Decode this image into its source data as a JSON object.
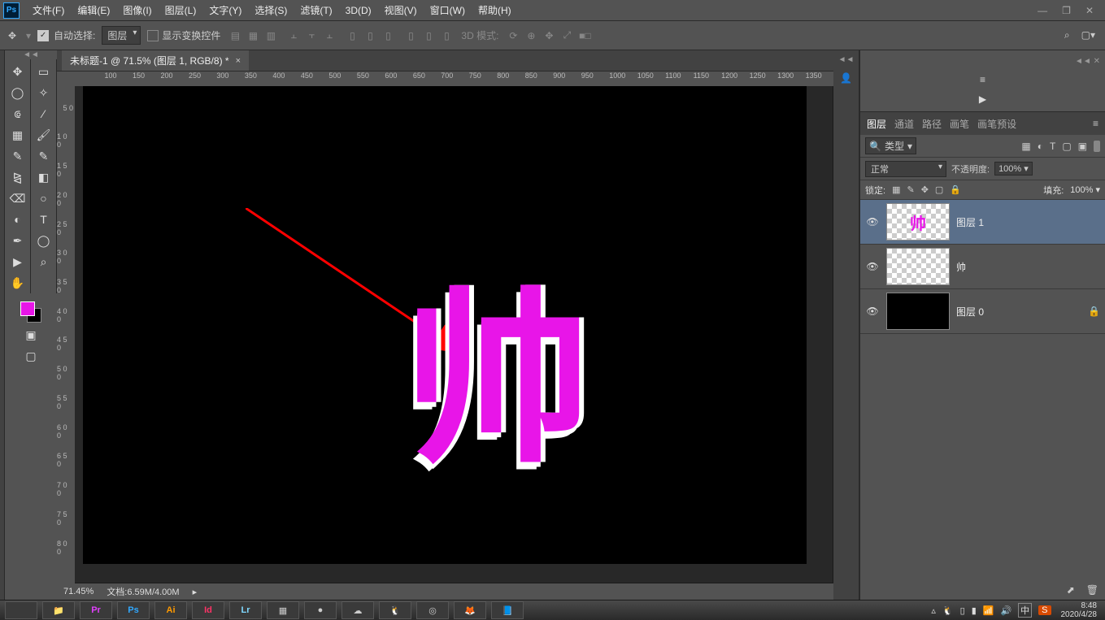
{
  "menubar": {
    "items": [
      "文件(F)",
      "编辑(E)",
      "图像(I)",
      "图层(L)",
      "文字(Y)",
      "选择(S)",
      "滤镜(T)",
      "3D(D)",
      "视图(V)",
      "窗口(W)",
      "帮助(H)"
    ]
  },
  "window_controls": {
    "min": "—",
    "max": "❐",
    "close": "✕"
  },
  "options": {
    "autoselect_label": "自动选择:",
    "autoselect_target": "图层",
    "show_transform": "显示变换控件",
    "mode3d_label": "3D 模式:"
  },
  "document": {
    "tab_title": "未标题-1 @ 71.5% (图层 1, RGB/8) *",
    "zoom": "71.45%",
    "docinfo_label": "文档:",
    "docinfo_value": "6.59M/4.00M",
    "glyph": "帅"
  },
  "hruler": [
    "",
    "100",
    "150",
    "200",
    "250",
    "300",
    "350",
    "400",
    "450",
    "500",
    "550",
    "600",
    "650",
    "700",
    "750",
    "800",
    "850",
    "900",
    "950",
    "1000",
    "1050",
    "1100",
    "1150",
    "1200",
    "1250",
    "1300",
    "1350"
  ],
  "vruler": [
    "",
    "5 0",
    "1 0 0",
    "1 5 0",
    "2 0 0",
    "2 5 0",
    "3 0 0",
    "3 5 0",
    "4 0 0",
    "4 5 0",
    "5 0 0",
    "5 5 0",
    "6 0 0",
    "6 5 0",
    "7 0 0",
    "7 5 0",
    "8 0 0"
  ],
  "panels": {
    "tabs": {
      "layers": "图层",
      "channels": "通道",
      "paths": "路径",
      "brushes": "画笔",
      "presets": "画笔预设"
    },
    "filter_label": "类型",
    "blend_mode": "正常",
    "opacity_label": "不透明度:",
    "opacity_value": "100%",
    "lock_label": "锁定:",
    "fill_label": "填充:",
    "fill_value": "100%",
    "layers_list": [
      {
        "name": "图层 1",
        "selected": true,
        "thumb": "ck",
        "mark": "帅"
      },
      {
        "name": "帅",
        "selected": false,
        "thumb": "ck",
        "mark": ""
      },
      {
        "name": "图层 0",
        "selected": false,
        "thumb": "black",
        "mark": "",
        "locked": true
      }
    ]
  },
  "taskbar": {
    "apps": [
      {
        "code": "",
        "cls": ""
      },
      {
        "code": "📁",
        "cls": ""
      },
      {
        "code": "Pr",
        "cls": "prlogo"
      },
      {
        "code": "Ps",
        "cls": "pslogo"
      },
      {
        "code": "Ai",
        "cls": "ailogo"
      },
      {
        "code": "Id",
        "cls": "idlogo"
      },
      {
        "code": "Lr",
        "cls": "lrlogo"
      },
      {
        "code": "▦",
        "cls": ""
      },
      {
        "code": "●",
        "cls": ""
      },
      {
        "code": "☁",
        "cls": ""
      },
      {
        "code": "🐧",
        "cls": ""
      },
      {
        "code": "◎",
        "cls": ""
      },
      {
        "code": "🦊",
        "cls": ""
      },
      {
        "code": "📘",
        "cls": ""
      }
    ],
    "time": "8:48",
    "date": "2020/4/28",
    "ime": "中",
    "s": "S"
  },
  "colors": {
    "accent": "#e815e8"
  }
}
